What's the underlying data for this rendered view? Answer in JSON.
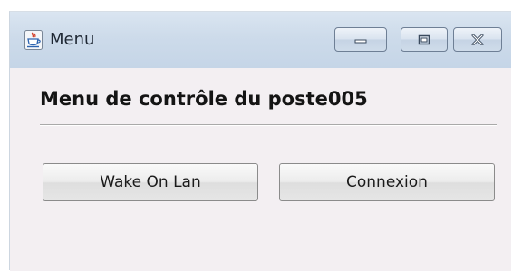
{
  "window": {
    "title": "Menu",
    "icon": "java-cup-icon",
    "controls": {
      "minimize": "minimize-icon",
      "maximize": "maximize-icon",
      "close": "close-icon"
    }
  },
  "main": {
    "heading": "Menu de contrôle du poste005",
    "buttons": {
      "wake_on_lan": "Wake On Lan",
      "connexion": "Connexion"
    }
  },
  "colors": {
    "titlebar": "#cddbea",
    "content_background": "#f3eff2",
    "separator": "#a9a9a9"
  }
}
